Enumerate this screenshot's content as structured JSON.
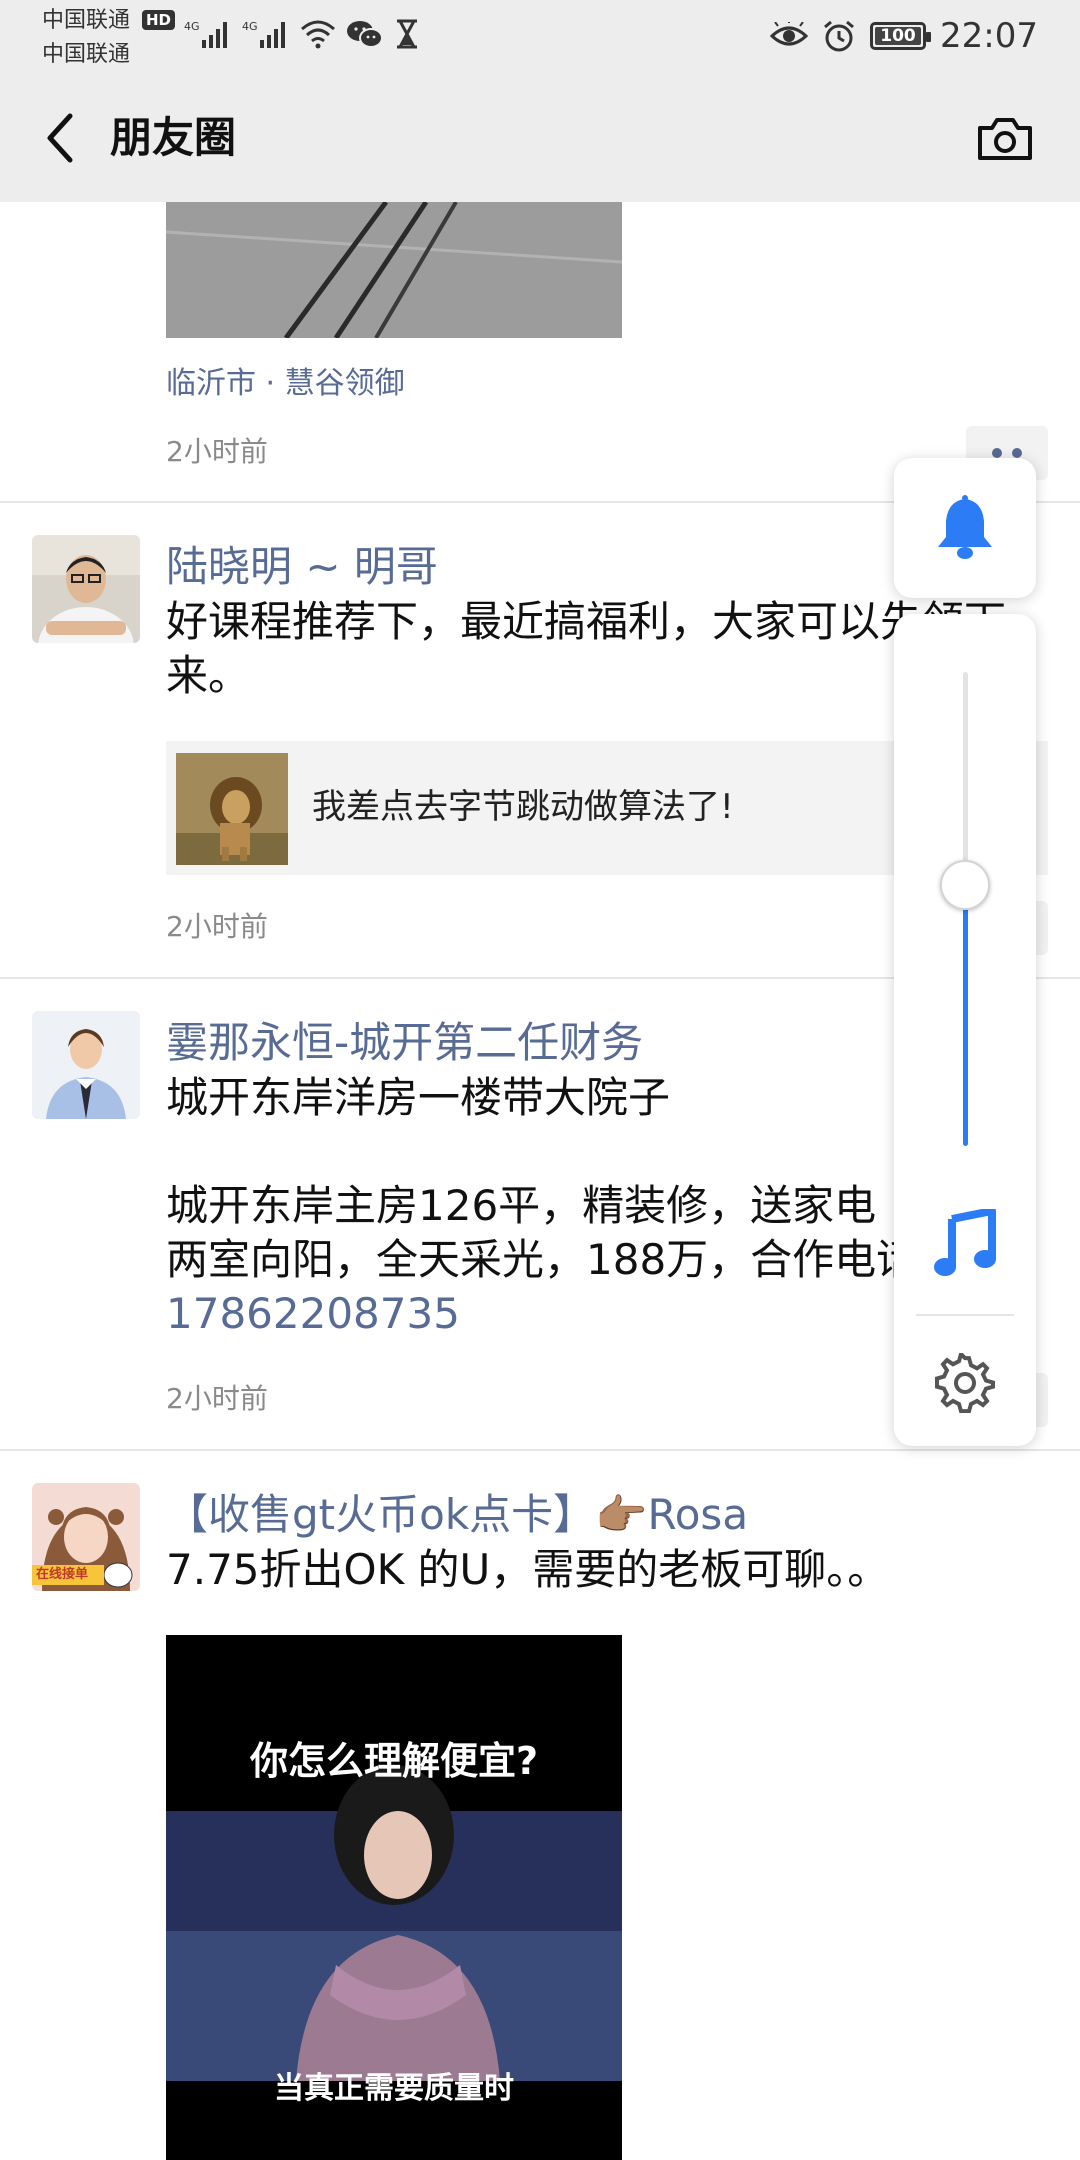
{
  "status_bar": {
    "carrier_1": "中国联通",
    "carrier_2": "中国联通",
    "hd_badge": "HD",
    "network_1": "4G",
    "network_2": "4G",
    "battery": "100",
    "time": "22:07"
  },
  "navbar": {
    "title": "朋友圈"
  },
  "posts": [
    {
      "location": "临沂市 · 慧谷领御",
      "time": "2小时前"
    },
    {
      "name": "陆晓明 ~ 明哥",
      "text": "好课程推荐下，最近搞福利，大家可以先领下来。",
      "link_title": "我差点去字节跳动做算法了!",
      "time": "2小时前"
    },
    {
      "name": "霎那永恒-城开第二任财务",
      "text": "城开东岸洋房一楼带大院子\n\n城开东岸主房126平，精装修，送家电\n两室向阳，全天采光，188万，合作电话",
      "phone": "17862208735",
      "time": "2小时前"
    },
    {
      "name": "【收售gt火币ok点卡】👉🏽Rosa",
      "avatar_badge": "在线接单",
      "text": "7.75折出OK 的U，需要的老板可聊。。",
      "image_caption_top": "你怎么理解便宜?",
      "image_caption_bottom": "当真正需要质量时"
    }
  ],
  "volume_panel": {
    "level": 0.55,
    "accent_color": "#2c7cf6",
    "icons": [
      "bell-icon",
      "music-note-icon",
      "gear-icon"
    ]
  }
}
